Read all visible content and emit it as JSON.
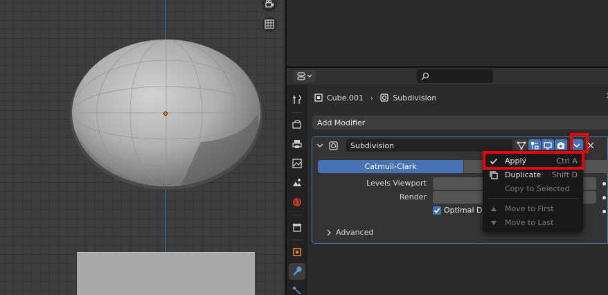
{
  "properties": {
    "search": {
      "placeholder": ""
    },
    "breadcrumb": {
      "object": "Cube.001",
      "modifier": "Subdivision"
    },
    "add_modifier_label": "Add Modifier",
    "modifier": {
      "name": "Subdivision",
      "type_options": [
        "Catmull-Clark",
        ""
      ],
      "selected_type": "Catmull-Clark",
      "fields": [
        {
          "label": "Levels Viewport",
          "value": ""
        },
        {
          "label": "Render",
          "value": ""
        }
      ],
      "optimal_display_label": "Optimal Dis",
      "optimal_display_checked": true,
      "advanced_label": "Advanced"
    }
  },
  "dropdown_menu": {
    "items": [
      {
        "label": "Apply",
        "shortcut": "Ctrl A",
        "icon": "check-icon",
        "enabled": true
      },
      {
        "label": "Duplicate",
        "shortcut": "Shift D",
        "icon": "duplicate-icon",
        "enabled": true
      },
      {
        "label": "Copy to Selected",
        "shortcut": "",
        "icon": "",
        "enabled": false
      },
      {
        "label": "Move to First",
        "shortcut": "",
        "icon": "triangle-up-icon",
        "enabled": false
      },
      {
        "label": "Move to Last",
        "shortcut": "",
        "icon": "triangle-down-icon",
        "enabled": false
      }
    ]
  },
  "highlights": {
    "color": "#ee0000",
    "targets": [
      "dropdown-toggle-button",
      "apply-menu-item"
    ]
  },
  "colors": {
    "accent": "#4772b3",
    "panel_bg": "#2b2b2b",
    "viewport_bg": "#3d3d3d"
  }
}
